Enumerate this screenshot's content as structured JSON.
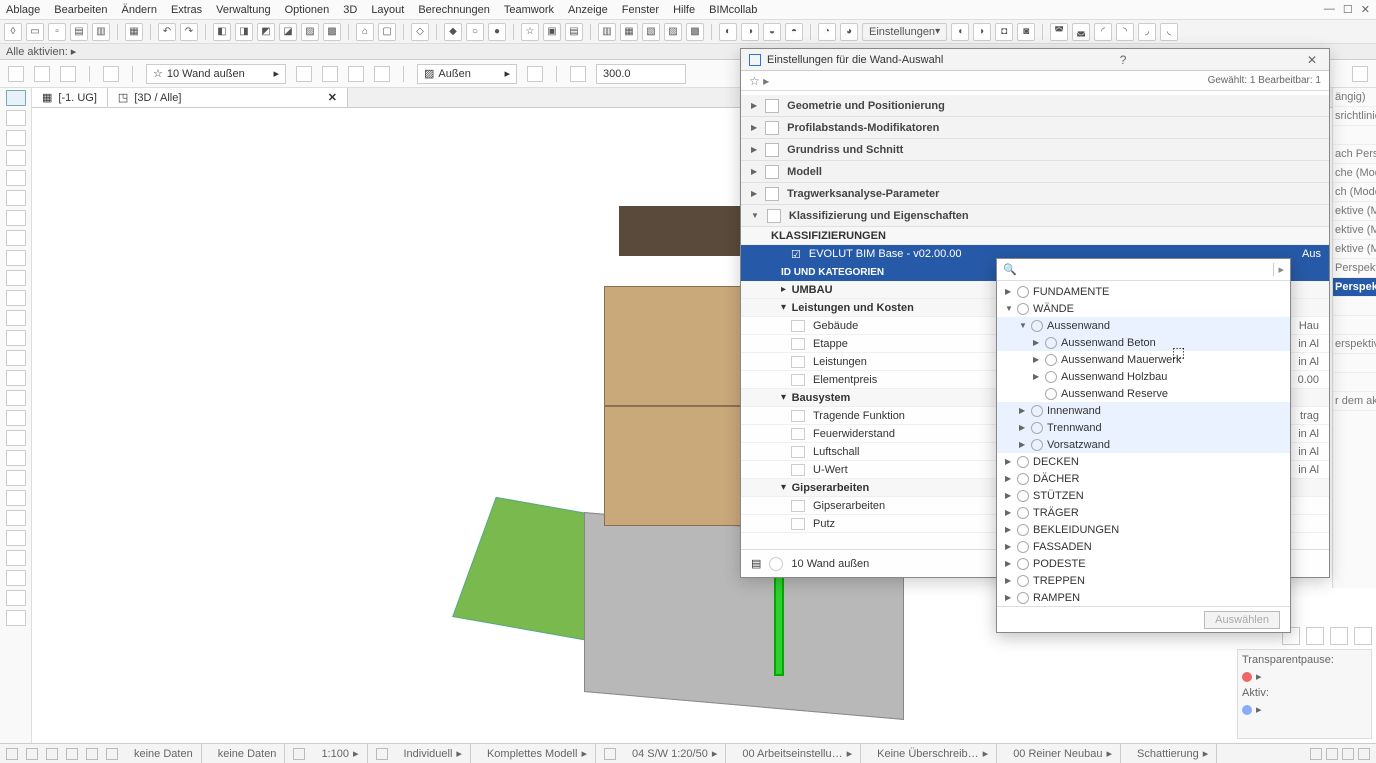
{
  "menu": [
    "Ablage",
    "Bearbeiten",
    "Ändern",
    "Extras",
    "Verwaltung",
    "Optionen",
    "3D",
    "Layout",
    "Berechnungen",
    "Teamwork",
    "Anzeige",
    "Fenster",
    "Hilfe",
    "BIMcollab"
  ],
  "status_strip": "Alle aktivien: ▸",
  "topbar": {
    "dropdown": "Einstellungen"
  },
  "optbar": {
    "favorite": "10 Wand außen",
    "layer": "Außen",
    "value": "300.0"
  },
  "tabs": [
    {
      "label": "[-1. UG]"
    },
    {
      "label": "[3D / Alle]"
    }
  ],
  "dialog": {
    "title": "Einstellungen für die Wand-Auswahl",
    "selected": "Gewählt: 1 Bearbeitbar: 1",
    "sections": [
      "Geometrie und Positionierung",
      "Profilabstands-Modifikatoren",
      "Grundriss und Schnitt",
      "Modell",
      "Tragwerksanalyse-Parameter",
      "Klassifizierung und Eigenschaften"
    ],
    "klass_hdr": "KLASSIFIZIERUNGEN",
    "klass_row": "EVOLUT BIM Base - v02.00.00",
    "klass_val": "Aus",
    "idcat": "ID UND KATEGORIEN",
    "umbau": "UMBAU",
    "groups": {
      "lk": "Leistungen und Kosten",
      "lk_rows": [
        {
          "k": "Gebäude",
          "v": "Hau"
        },
        {
          "k": "Etappe",
          "v": "in Al"
        },
        {
          "k": "Leistungen",
          "v": "in Al"
        },
        {
          "k": "Elementpreis",
          "v": "0.00"
        }
      ],
      "bs": "Bausystem",
      "bs_rows": [
        {
          "k": "Tragende Funktion",
          "v": "trag"
        },
        {
          "k": "Feuerwiderstand",
          "v": "in Al"
        },
        {
          "k": "Luftschall",
          "v": "in Al"
        },
        {
          "k": "U-Wert",
          "v": "in Al"
        }
      ],
      "gp": "Gipserarbeiten",
      "gp_rows": [
        {
          "k": "Gipserarbeiten",
          "v": ""
        },
        {
          "k": "Putz",
          "v": ""
        }
      ]
    },
    "footer": "10 Wand außen"
  },
  "popup": {
    "tree": [
      {
        "lvl": 1,
        "exp": "▶",
        "label": "FUNDAMENTE"
      },
      {
        "lvl": 1,
        "exp": "▼",
        "label": "WÄNDE"
      },
      {
        "lvl": 2,
        "exp": "▼",
        "label": "Aussenwand"
      },
      {
        "lvl": 3,
        "exp": "▶",
        "label": "Aussenwand Beton",
        "hov": true
      },
      {
        "lvl": 3,
        "exp": "▶",
        "label": "Aussenwand Mauerwerk"
      },
      {
        "lvl": 3,
        "exp": "▶",
        "label": "Aussenwand Holzbau"
      },
      {
        "lvl": 3,
        "exp": "",
        "label": "Aussenwand Reserve"
      },
      {
        "lvl": 2,
        "exp": "▶",
        "label": "Innenwand"
      },
      {
        "lvl": 2,
        "exp": "▶",
        "label": "Trennwand"
      },
      {
        "lvl": 2,
        "exp": "▶",
        "label": "Vorsatzwand"
      },
      {
        "lvl": 1,
        "exp": "▶",
        "label": "DECKEN"
      },
      {
        "lvl": 1,
        "exp": "▶",
        "label": "DÄCHER"
      },
      {
        "lvl": 1,
        "exp": "▶",
        "label": "STÜTZEN"
      },
      {
        "lvl": 1,
        "exp": "▶",
        "label": "TRÄGER"
      },
      {
        "lvl": 1,
        "exp": "▶",
        "label": "BEKLEIDUNGEN"
      },
      {
        "lvl": 1,
        "exp": "▶",
        "label": "FASSADEN"
      },
      {
        "lvl": 1,
        "exp": "▶",
        "label": "PODESTE"
      },
      {
        "lvl": 1,
        "exp": "▶",
        "label": "TREPPEN"
      },
      {
        "lvl": 1,
        "exp": "▶",
        "label": "RAMPEN"
      }
    ],
    "btn": "Auswählen"
  },
  "rpeek": {
    "items": [
      "ängig)",
      "srichtlinie",
      "",
      "ach Persp",
      "che (Mode",
      "ch (Mode",
      "ektive (M",
      "ektive (M",
      "ektive (Mo",
      "Perspekti"
    ],
    "hdr": "Perspekt",
    "after": [
      "erspektive",
      "r dem aktuellen Ge"
    ]
  },
  "tp": {
    "l1": "Transparentpause:",
    "l2": "Aktiv:"
  },
  "statusbar": {
    "cells": [
      "keine Daten",
      "keine Daten",
      "1:100",
      "Individuell",
      "Komplettes Modell",
      "04 S/W 1:20/50",
      "00 Arbeitseinstellu…",
      "Keine Überschreib…",
      "00 Reiner Neubau",
      "Schattierung"
    ]
  }
}
